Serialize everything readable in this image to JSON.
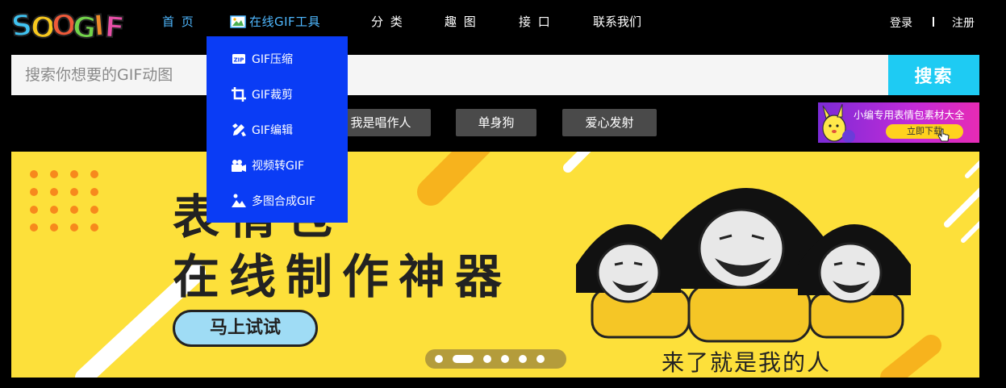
{
  "brand": {
    "logo_text": "SOOGIF"
  },
  "nav": {
    "items": [
      {
        "label": "首 页"
      },
      {
        "label": "在线GIF工具"
      },
      {
        "label": "分 类"
      },
      {
        "label": "趣 图"
      },
      {
        "label": "接 口"
      },
      {
        "label": "联系我们"
      }
    ]
  },
  "auth": {
    "login": "登录",
    "register": "注册"
  },
  "search": {
    "placeholder": "搜索你想要的GIF动图",
    "button": "搜索"
  },
  "tags": [
    "我是唱作人",
    "单身狗",
    "爱心发射"
  ],
  "ad": {
    "title": "小编专用表情包素材大全",
    "button": "立即下载"
  },
  "banner": {
    "title_line1": "表情包",
    "title_line2": "在线制作神器",
    "cta": "马上试试",
    "caption": "来了就是我的人",
    "slides_total": 6,
    "active_slide": 2
  },
  "dropdown": {
    "items": [
      {
        "label": "GIF压缩",
        "icon": "zip-icon"
      },
      {
        "label": "GIF裁剪",
        "icon": "crop-icon"
      },
      {
        "label": "GIF编辑",
        "icon": "edit-icon"
      },
      {
        "label": "视频转GIF",
        "icon": "video-icon"
      },
      {
        "label": "多图合成GIF",
        "icon": "images-icon"
      }
    ]
  },
  "colors": {
    "accent_nav": "#4fb8ff",
    "search_button": "#1ecbf3",
    "dropdown_bg": "#0a3cf5",
    "banner_bg": "#fde03a",
    "tag_bg": "#4a4a4a"
  }
}
